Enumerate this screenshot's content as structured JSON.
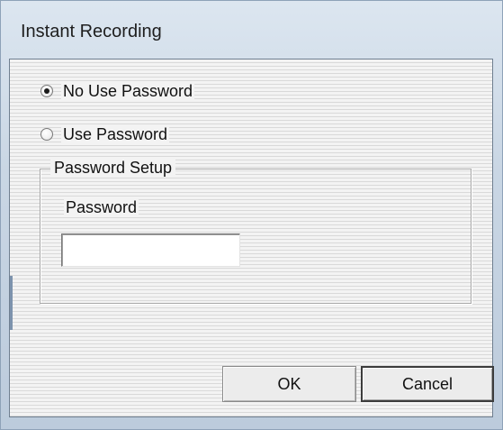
{
  "window": {
    "title": "Instant Recording"
  },
  "options": {
    "no_use_password": {
      "label": "No Use Password",
      "selected": true
    },
    "use_password": {
      "label": "Use Password",
      "selected": false
    }
  },
  "password_setup": {
    "legend": "Password Setup",
    "password_label": "Password",
    "password_value": ""
  },
  "buttons": {
    "ok_label": "OK",
    "cancel_label": "Cancel"
  }
}
